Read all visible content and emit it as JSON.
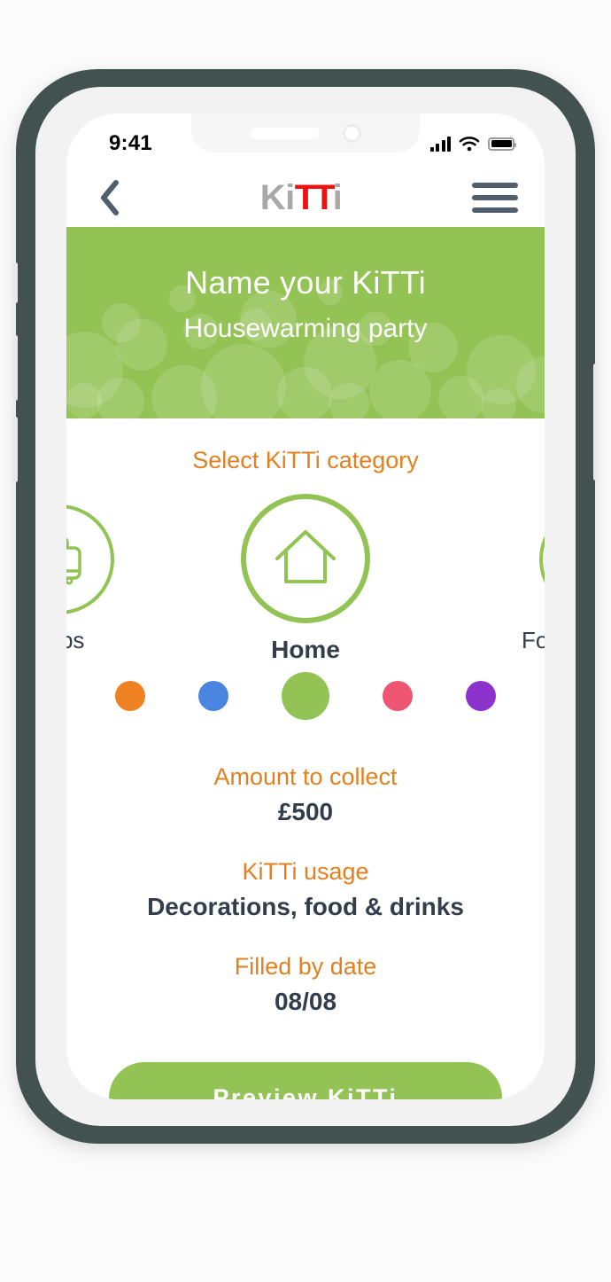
{
  "status_bar": {
    "time": "9:41",
    "signal_icon": "signal-bars-icon",
    "wifi_icon": "wifi-icon",
    "battery_icon": "battery-full-icon"
  },
  "header": {
    "back_icon": "chevron-left-icon",
    "menu_icon": "hamburger-menu-icon",
    "logo": {
      "part1": "Ki",
      "part2": "TT",
      "part3": "i",
      "gray_color": "#a8a8a8",
      "red_color": "#ee1111"
    }
  },
  "banner": {
    "title": "Name your KiTTi",
    "subtitle": "Housewarming party",
    "background_color": "#93c355"
  },
  "category": {
    "label": "Select KiTTi category",
    "items": [
      {
        "name": "Trips",
        "label": "Trips",
        "icon": "suitcase-icon",
        "selected": false
      },
      {
        "name": "Home",
        "label": "Home",
        "icon": "house-icon",
        "selected": true
      },
      {
        "name": "Food",
        "label": "Food & Drinks",
        "icon": "burger-icon",
        "selected": false
      }
    ]
  },
  "colors": {
    "swatches": [
      {
        "name": "orange",
        "hex": "#ee8222",
        "selected": false
      },
      {
        "name": "blue",
        "hex": "#4a86e0",
        "selected": false
      },
      {
        "name": "green",
        "hex": "#93c355",
        "selected": true
      },
      {
        "name": "pink",
        "hex": "#ee5571",
        "selected": false
      },
      {
        "name": "purple",
        "hex": "#8b33cc",
        "selected": false
      }
    ]
  },
  "details": {
    "amount_label": "Amount to collect",
    "amount_value": "£500",
    "usage_label": "KiTTi usage",
    "usage_value": "Decorations, food & drinks",
    "date_label": "Filled by date",
    "date_value": "08/08"
  },
  "cta": {
    "label": "Preview KiTTi"
  },
  "theme": {
    "accent_green": "#93c355",
    "accent_orange": "#e2801f",
    "text_dark": "#333e4d",
    "frame_color": "#41524f"
  }
}
